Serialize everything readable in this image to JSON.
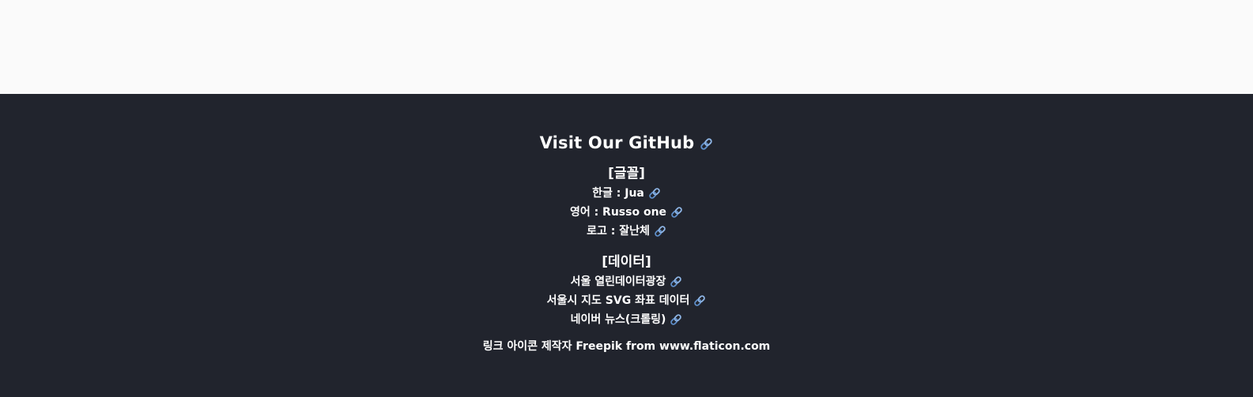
{
  "footer": {
    "github_title": "Visit Our GitHub",
    "fonts_section": {
      "title": "[글꼴]",
      "items": [
        {
          "label": "한글 : Jua"
        },
        {
          "label": "영어 : Russo one"
        },
        {
          "label": "로고 : 잘난체"
        }
      ]
    },
    "data_section": {
      "title": "[데이터]",
      "items": [
        {
          "label": "서울 열린데이터광장"
        },
        {
          "label": "서울시 지도 SVG 좌표 데이터"
        },
        {
          "label": "네이버 뉴스(크롤링)"
        }
      ]
    },
    "credit": "링크 아이콘 제작자 Freepik from www.flaticon.com",
    "icon": "link-icon",
    "colors": {
      "background": "#21242d",
      "top_background": "#fafafa",
      "text": "#ffffff",
      "icon_blue": "#8fb6e6",
      "icon_blue_dark": "#5f8fca"
    }
  }
}
